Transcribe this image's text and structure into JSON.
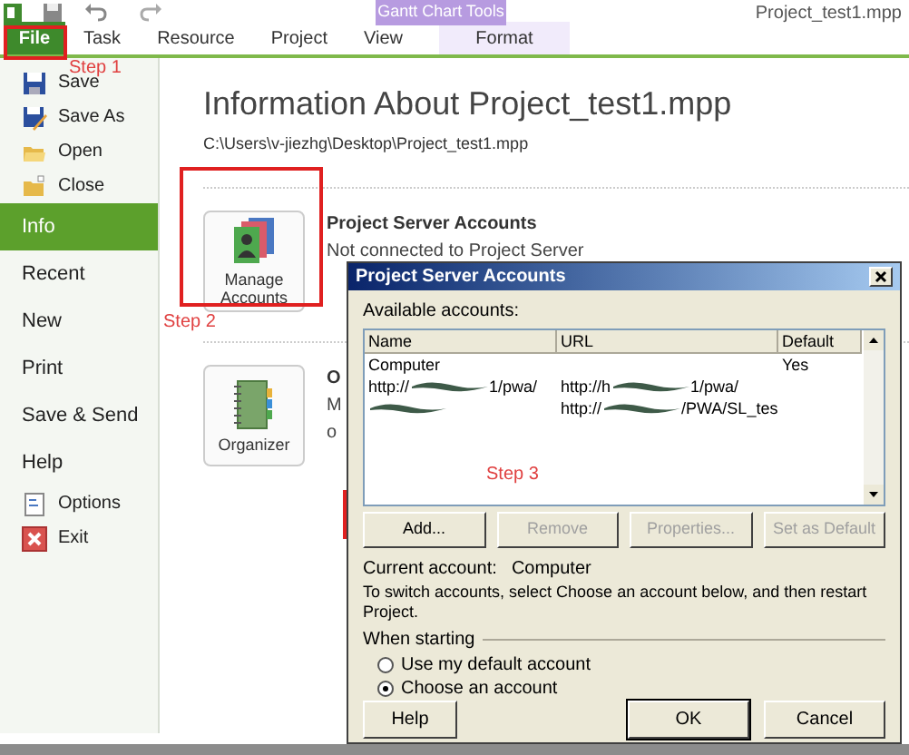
{
  "window": {
    "title": "Project_test1.mpp"
  },
  "contextual_tab_group": {
    "label": "Gantt Chart Tools"
  },
  "tabs": [
    {
      "label": "File",
      "selected": true,
      "kind": "file"
    },
    {
      "label": "Task",
      "selected": false,
      "kind": "normal"
    },
    {
      "label": "Resource",
      "selected": false,
      "kind": "normal"
    },
    {
      "label": "Project",
      "selected": false,
      "kind": "normal"
    },
    {
      "label": "View",
      "selected": false,
      "kind": "normal"
    },
    {
      "label": "Format",
      "selected": false,
      "kind": "contextual"
    }
  ],
  "sidebar": {
    "items": [
      {
        "label": "Save",
        "kind": "command",
        "selected": false
      },
      {
        "label": "Save As",
        "kind": "command",
        "selected": false
      },
      {
        "label": "Open",
        "kind": "command",
        "selected": false
      },
      {
        "label": "Close",
        "kind": "command",
        "selected": false
      },
      {
        "label": "Info",
        "kind": "section",
        "selected": true
      },
      {
        "label": "Recent",
        "kind": "section",
        "selected": false
      },
      {
        "label": "New",
        "kind": "section",
        "selected": false
      },
      {
        "label": "Print",
        "kind": "section",
        "selected": false
      },
      {
        "label": "Save & Send",
        "kind": "section",
        "selected": false
      },
      {
        "label": "Help",
        "kind": "section",
        "selected": false
      },
      {
        "label": "Options",
        "kind": "command",
        "selected": false
      },
      {
        "label": "Exit",
        "kind": "command",
        "selected": false
      }
    ]
  },
  "info": {
    "heading": "Information About Project_test1.mpp",
    "path": "C:\\Users\\v-jiezhg\\Desktop\\Project_test1.mpp",
    "sections": [
      {
        "button": "Manage Accounts",
        "title": "Project Server Accounts",
        "lines": [
          "Not connected to Project Server"
        ]
      },
      {
        "button": "Organizer",
        "title": "O",
        "lines": [
          "M",
          "o"
        ]
      }
    ]
  },
  "annotations": [
    "Step 1",
    "Step 2",
    "Step 3"
  ],
  "dialog": {
    "title": "Project Server Accounts",
    "list_label": "Available accounts:",
    "columns": [
      "Name",
      "URL",
      "Default"
    ],
    "rows": [
      {
        "cells": [
          [
            "Computer"
          ],
          [],
          [
            "Yes"
          ]
        ]
      },
      {
        "cells": [
          [
            "http://",
            "1/pwa/"
          ],
          [
            "http://h",
            "1/pwa/"
          ],
          []
        ]
      },
      {
        "cells": [
          [
            "",
            ""
          ],
          [
            "http://",
            "/PWA/SL_tes"
          ],
          []
        ]
      }
    ],
    "buttons": [
      {
        "label": "Add...",
        "disabled": false
      },
      {
        "label": "Remove",
        "disabled": true
      },
      {
        "label": "Properties...",
        "disabled": true
      },
      {
        "label": "Set as Default",
        "disabled": true
      }
    ],
    "current_label": "Current account:",
    "current_value": "Computer",
    "hint": "To switch accounts, select Choose an account below, and then restart Project.",
    "group_label": "When starting",
    "options": [
      {
        "label": "Use my default account",
        "selected": false
      },
      {
        "label": "Choose an account",
        "selected": true
      }
    ],
    "footer_buttons": [
      {
        "label": "Help",
        "kind": "left"
      },
      {
        "label": "OK",
        "kind": "default"
      },
      {
        "label": "Cancel",
        "kind": "normal"
      }
    ]
  }
}
